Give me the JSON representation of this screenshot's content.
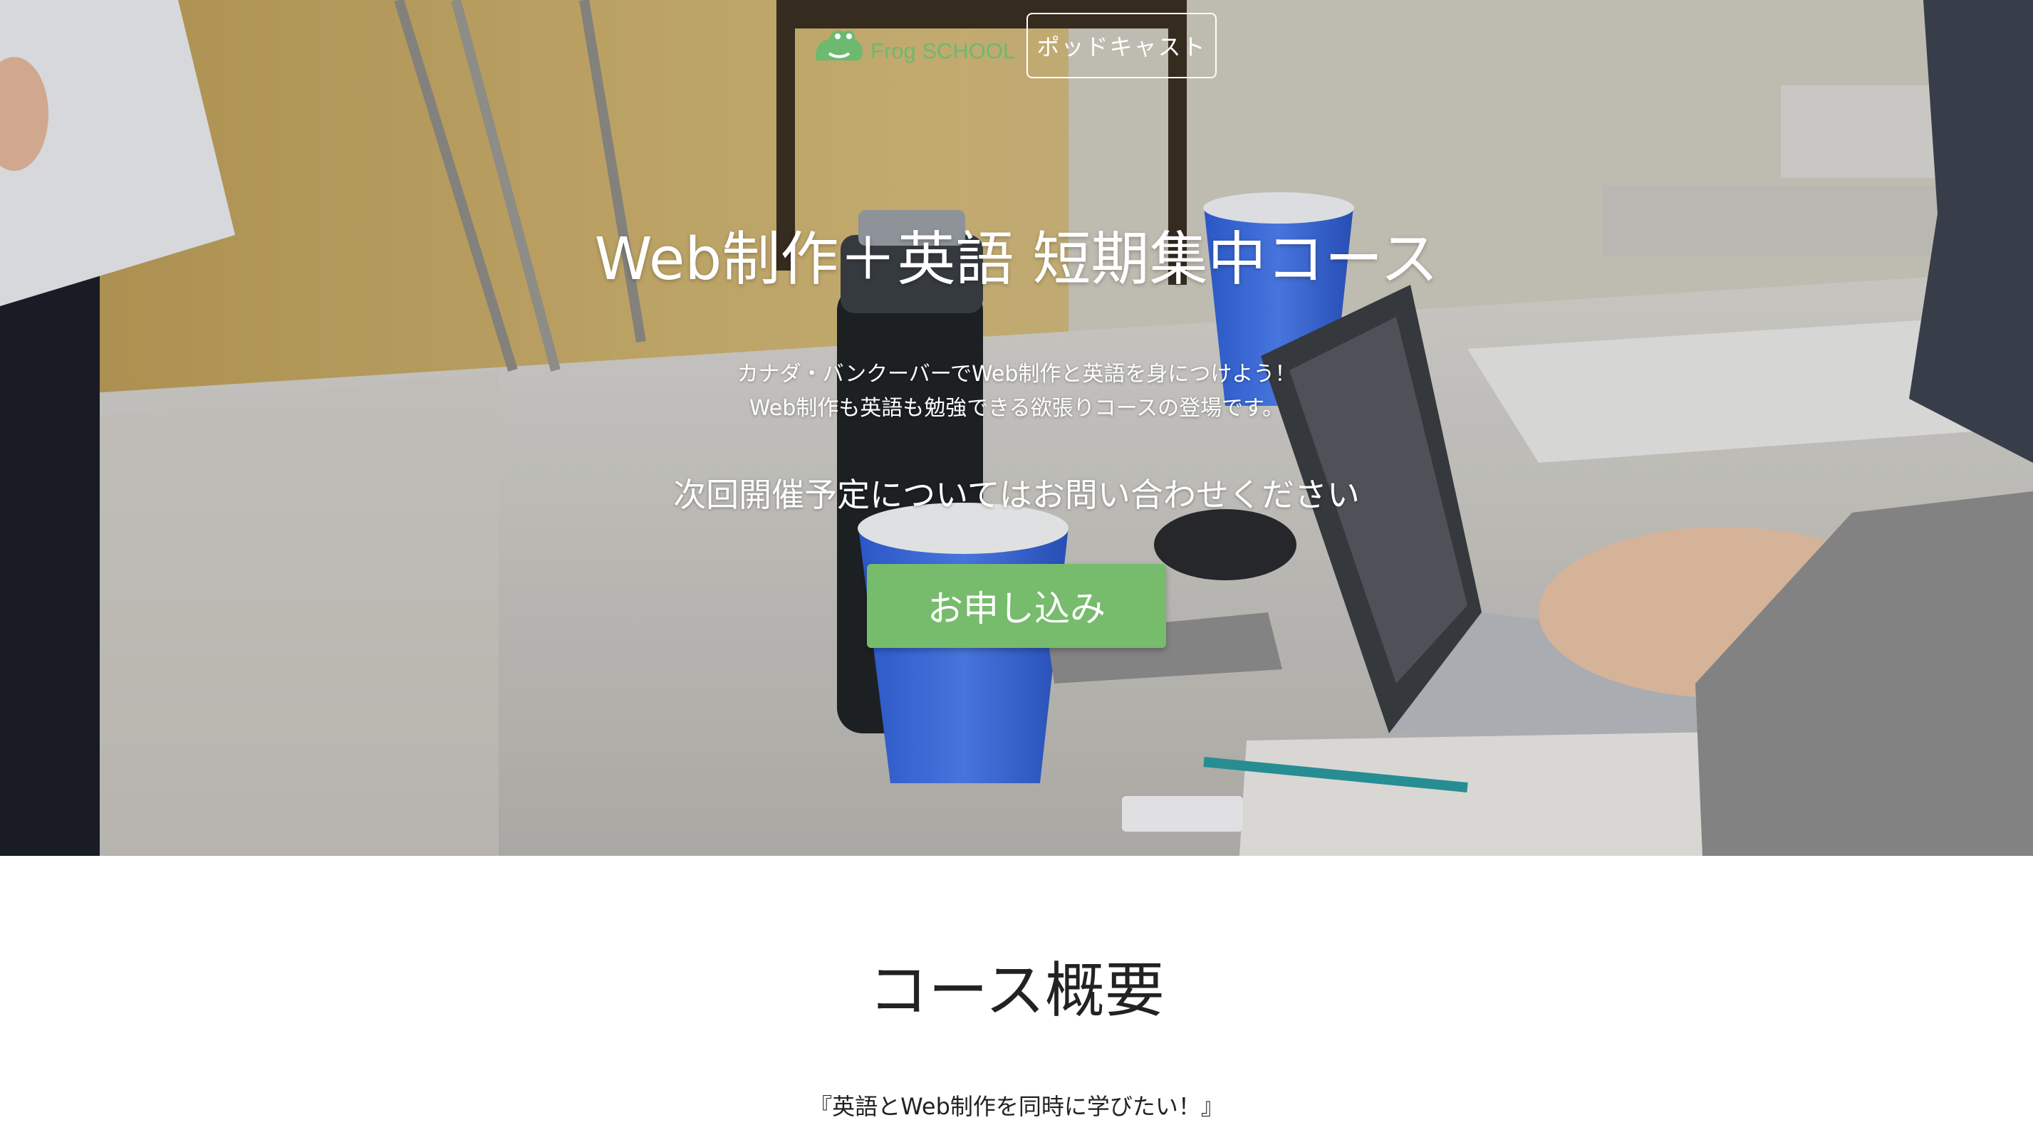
{
  "nav": {
    "logo_text": "Frog SCHOOL",
    "podcast_label": "ポッドキャスト"
  },
  "hero": {
    "title": "Web制作＋英語 短期集中コース",
    "subtitle_line1": "カナダ・バンクーバーでWeb制作と英語を身につけよう！",
    "subtitle_line2": "Web制作も英語も勉強できる欲張りコースの登場です。",
    "notice": "次回開催予定についてはお問い合わせください",
    "apply_label": "お申し込み"
  },
  "overview": {
    "title": "コース概要",
    "lead": "『英語とWeb制作を同時に学びたい！』"
  },
  "colors": {
    "brand_green": "#77bb6d",
    "logo_green": "#6db96f"
  }
}
